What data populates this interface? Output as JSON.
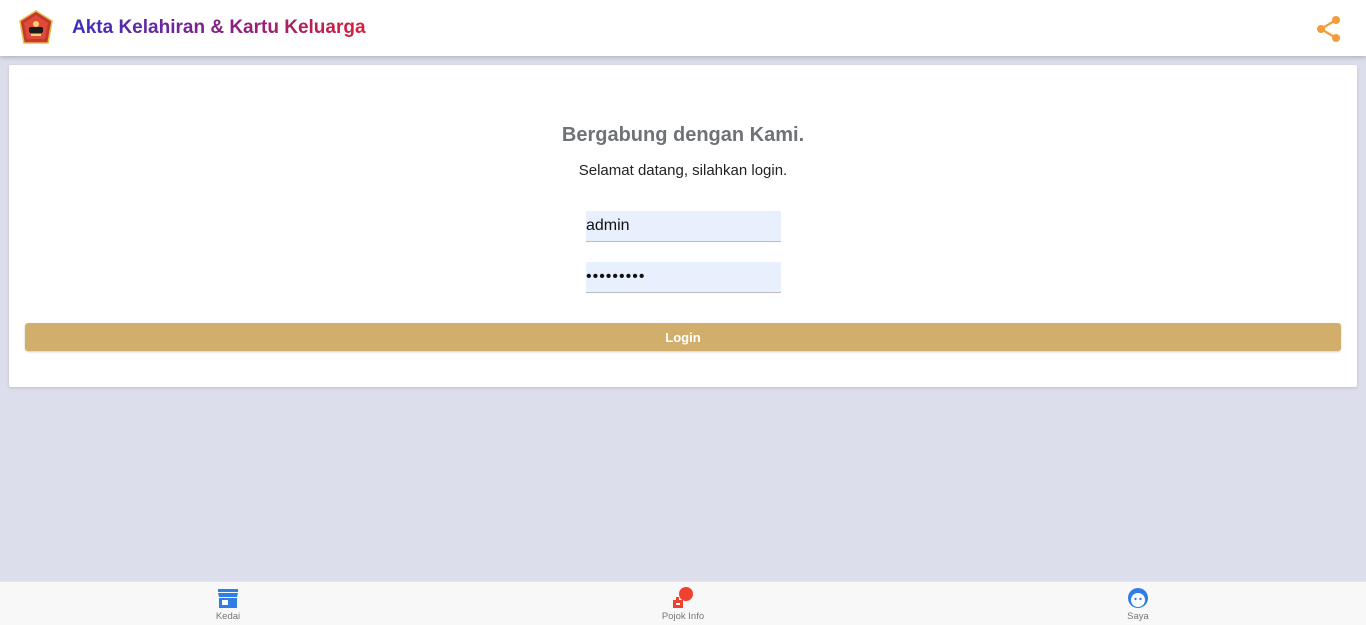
{
  "header": {
    "title": "Akta Kelahiran & Kartu Keluarga",
    "logo_icon": "emblem-logo-icon",
    "share_icon": "share-icon",
    "share_color": "#f39c3c"
  },
  "login": {
    "heading": "Bergabung dengan Kami.",
    "subheading": "Selamat datang, silahkan login.",
    "username_value": "admin",
    "password_value": "password1",
    "button_label": "Login",
    "button_color": "#d2ae6c",
    "field_bg": "#e8f0fe"
  },
  "bottom_nav": {
    "items": [
      {
        "label": "Kedai",
        "icon": "store-icon",
        "color": "#2f7ee8"
      },
      {
        "label": "Pojok Info",
        "icon": "info-corner-icon",
        "color": "#f04030"
      },
      {
        "label": "Saya",
        "icon": "face-icon",
        "color": "#2f7ee8"
      }
    ]
  }
}
